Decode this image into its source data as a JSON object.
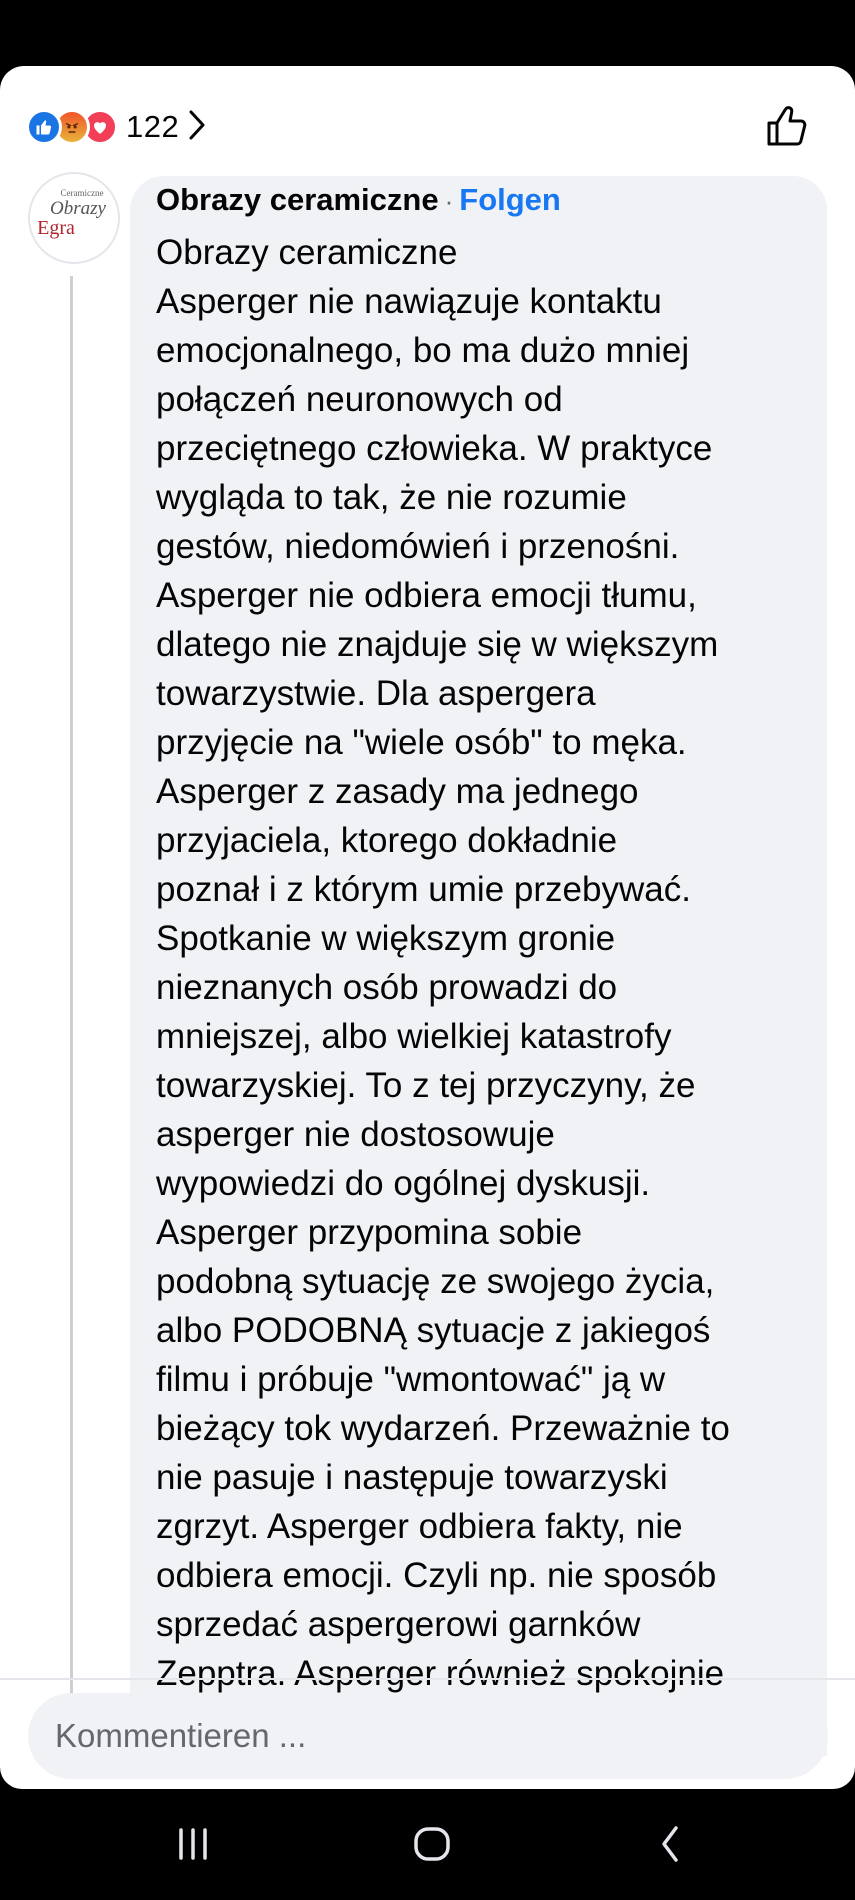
{
  "reactions": {
    "icons": [
      "like-icon",
      "angry-icon",
      "love-icon"
    ],
    "count": "122"
  },
  "avatar": {
    "logo_lines": [
      "Ceramiczne",
      "Obrazy",
      "Egra"
    ]
  },
  "comment": {
    "author": "Obrazy ceramiczne",
    "separator": "·",
    "follow_label": "Folgen",
    "text": "Obrazy ceramiczne\nAsperger nie nawiązuje kontaktu\nemocjonalnego, bo ma dużo mniej\npołączeń neuronowych od\nprzeciętnego człowieka. W praktyce\nwygląda to tak, że nie rozumie\ngestów, niedomówień i przenośni.\nAsperger nie odbiera emocji tłumu,\ndlatego nie znajduje się w większym\ntowarzystwie. Dla aspergera\nprzyjęcie na \"wiele osób\" to męka.\nAsperger z zasady ma jednego\nprzyjaciela, ktorego dokładnie\npoznał i z którym umie przebywać.\nSpotkanie w większym gronie\nnieznanych osób prowadzi do\nmniejszej, albo wielkiej katastrofy\ntowarzyskiej. To z tej przyczyny, że\nasperger nie dostosowuje\nwypowiedzi do ogólnej dyskusji.\nAsperger przypomina sobie\npodobną sytuację ze swojego życia,\nalbo PODOBNĄ sytuacje z jakiegoś\nfilmu i próbuje \"wmontować\" ją w\nbieżący tok wydarzeń. Przeważnie to\nnie pasuje i następuje towarzyski\nzgrzyt. Asperger odbiera fakty, nie\nodbiera emocji. Czyli np. nie sposób\nsprzedać aspergerowi garnków\nZepptra. Asperger również spokojnie"
  },
  "composer": {
    "placeholder": "Kommentieren ..."
  },
  "colors": {
    "accent": "#1877f2",
    "bubble": "#f0f2f5",
    "text": "#050505",
    "secondary_text": "#65676b"
  }
}
